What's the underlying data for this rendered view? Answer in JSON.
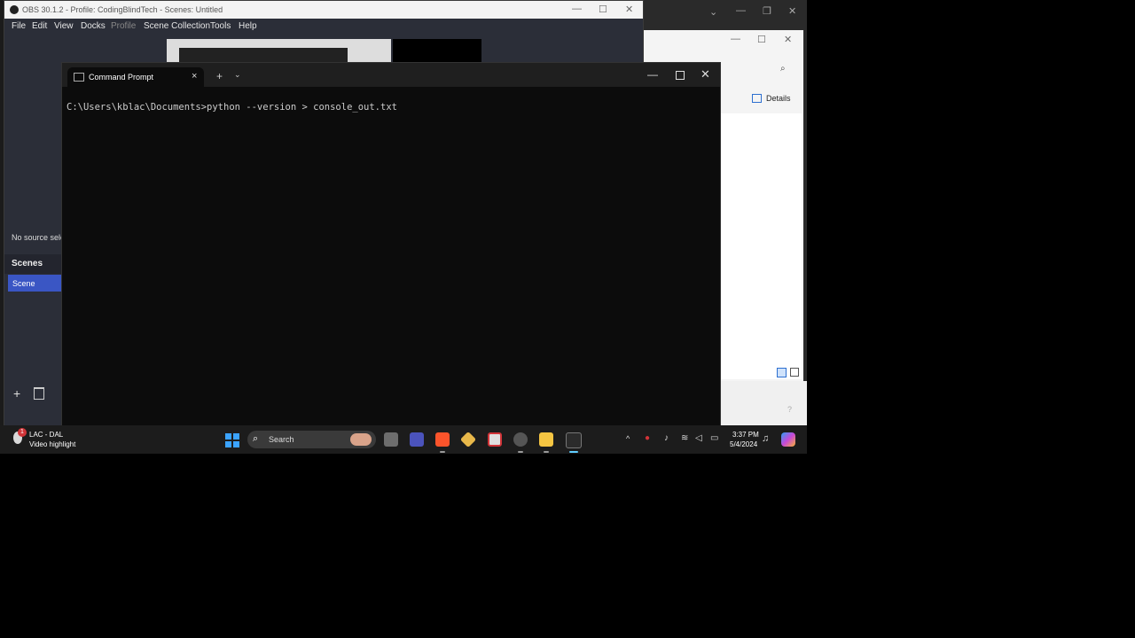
{
  "obs": {
    "title": "OBS 30.1.2 - Profile: CodingBlindTech - Scenes: Untitled",
    "menu": [
      "File",
      "Edit",
      "View",
      "Docks",
      "Profile",
      "Scene Collection",
      "Tools",
      "Help"
    ],
    "no_source": "No source sele",
    "scenes_header": "Scenes",
    "scene_item": "Scene",
    "add_label": "+"
  },
  "explorer": {
    "details_label": "Details"
  },
  "cmd": {
    "tab_title": "Command Prompt",
    "tab_close": "×",
    "new_tab": "+",
    "dropdown": "⌄",
    "command_line": "C:\\Users\\kblac\\Documents>python --version > console_out.txt"
  },
  "taskbar": {
    "notification_badge": "1",
    "notif_line1": "LAC - DAL",
    "notif_line2": "Video highlight",
    "search_placeholder": "Search",
    "time": "3:37 PM",
    "date": "5/4/2024"
  },
  "colors": {
    "obs_bg": "#2b2e38",
    "scene_selected": "#3a56c4",
    "cmd_bg": "#0c0c0c",
    "taskbar_bg": "#1c1c1c",
    "windows_accent": "#3ba3ff"
  },
  "icons": [
    "obs-logo-icon",
    "cmd-icon",
    "windows-start-icon",
    "search-icon",
    "trash-icon",
    "wifi-icon",
    "volume-icon",
    "battery-icon",
    "bell-icon",
    "copilot-icon"
  ]
}
